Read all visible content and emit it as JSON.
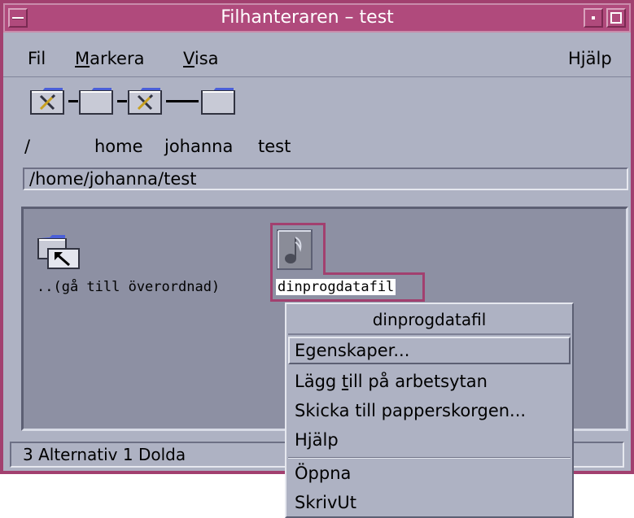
{
  "window": {
    "title": "Filhanteraren – test"
  },
  "menubar": {
    "fil": "Fil",
    "markera": "Markera",
    "markera_mnemonic": "M",
    "markera_rest": "arkera",
    "visa": "Visa",
    "visa_mnemonic": "V",
    "visa_rest": "isa",
    "hjalp": "Hjälp"
  },
  "path_icons": [
    {
      "label": "/",
      "icon": "folder-tools-icon"
    },
    {
      "label": "home",
      "icon": "folder-icon"
    },
    {
      "label": "johanna",
      "icon": "folder-tools-icon"
    },
    {
      "label": "test",
      "icon": "folder-icon"
    }
  ],
  "pathfield": {
    "value": "/home/johanna/test"
  },
  "files": [
    {
      "label": "..(gå till överordnad)",
      "icon": "parent-folder-icon"
    },
    {
      "label": "dinprogdatafil",
      "icon": "audio-file-icon",
      "selected": true
    }
  ],
  "statusbar": {
    "text": "3 Alternativ 1 Dolda"
  },
  "context_menu": {
    "title": "dinprogdatafil",
    "items": [
      {
        "label": "Egenskaper...",
        "active": true
      },
      {
        "label": "Lägg till på arbetsytan",
        "pre": "Lägg ",
        "mnemonic": "t",
        "post": "ill på arbetsytan"
      },
      {
        "label": "Skicka till papperskorgen..."
      },
      {
        "label": "Hjälp"
      },
      {
        "label": "Öppna"
      },
      {
        "label": "SkrivUt"
      }
    ]
  },
  "colors": {
    "titlebar": "#b04a7c",
    "window_frame": "#a2406f",
    "background": "#aeb2c3",
    "content_pane": "#8d90a3"
  }
}
